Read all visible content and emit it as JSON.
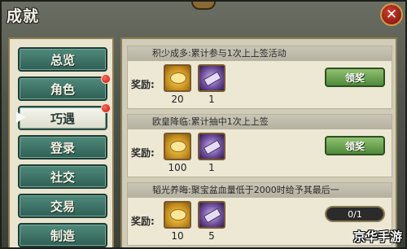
{
  "window": {
    "title": "成就",
    "close_glyph": "✕"
  },
  "nav": {
    "items": [
      {
        "label": "总览",
        "badge": false,
        "selected": false
      },
      {
        "label": "角色",
        "badge": true,
        "selected": false
      },
      {
        "label": "巧遇",
        "badge": true,
        "selected": true
      },
      {
        "label": "登录",
        "badge": false,
        "selected": false
      },
      {
        "label": "社交",
        "badge": false,
        "selected": false
      },
      {
        "label": "交易",
        "badge": false,
        "selected": false
      },
      {
        "label": "制造",
        "badge": false,
        "selected": false
      }
    ]
  },
  "achievements": [
    {
      "title": "积少成多:累计参与1次上上签活动",
      "reward_label": "奖励:",
      "rewards": [
        {
          "icon": "gold-coins-icon",
          "qty": "20"
        },
        {
          "icon": "purple-scroll-icon",
          "qty": "1"
        }
      ],
      "action": "领奖"
    },
    {
      "title": "欧皇降临:累计抽中1次上上签",
      "reward_label": "奖励:",
      "rewards": [
        {
          "icon": "gold-coins-icon",
          "qty": "100"
        },
        {
          "icon": "purple-scroll-icon",
          "qty": "1"
        }
      ],
      "action": "领奖"
    },
    {
      "title": "韬光养晦:聚宝盆血量低于2000时给予其最后一",
      "reward_label": "奖励:",
      "rewards": [
        {
          "icon": "gold-coins-icon",
          "qty": "10"
        },
        {
          "icon": "purple-scroll-icon",
          "qty": "5"
        }
      ],
      "progress": "0/1",
      "progress_fraction": 0
    }
  ],
  "watermark": "京华手游"
}
